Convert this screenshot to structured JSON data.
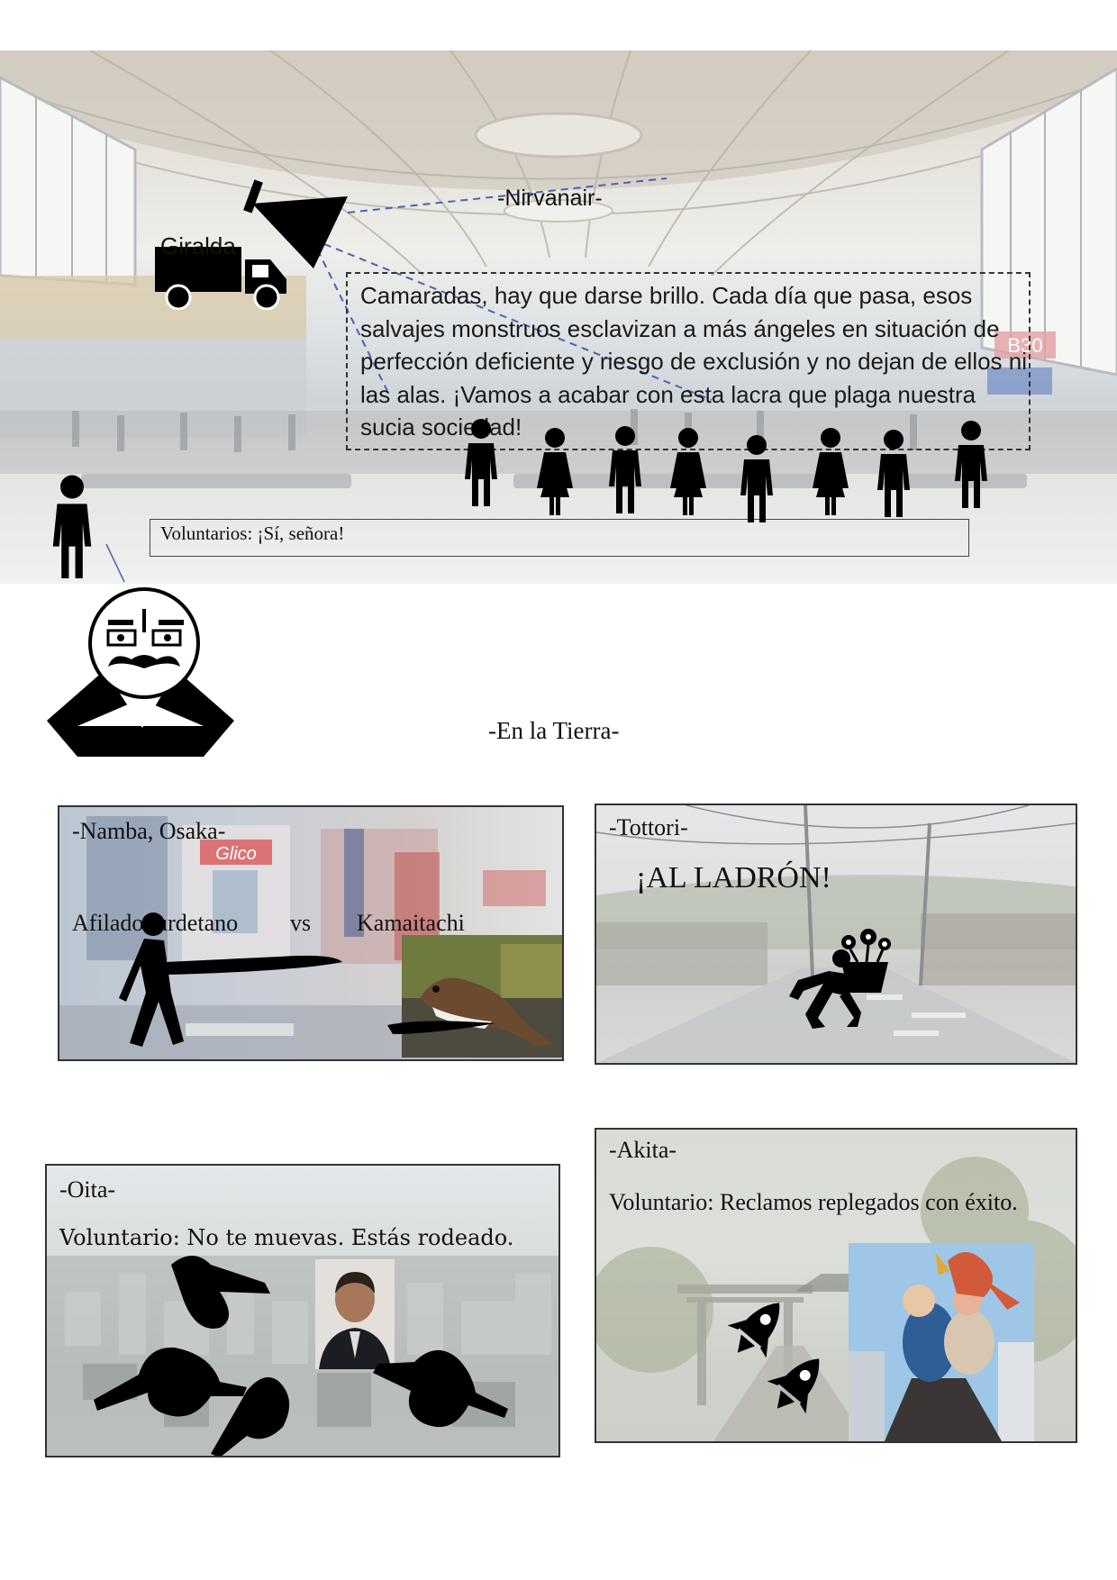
{
  "airport_scene": {
    "location_title": "-Nirvanair-",
    "speaker_label": "Giralda",
    "speech": "Camaradas, hay que darse brillo. Cada día que pasa, esos salvajes monstruos esclavizan a más ángeles en situación de perfección deficiente y riesgo de exclusión y no dejan de ellos ni las alas. ¡Vamos a acabar con esta lacra que plaga nuestra sucia sociedad!",
    "volunteers_reply": "Voluntarios:  ¡Sí, señora!",
    "gate_sign": "B30"
  },
  "earth_heading": "-En la Tierra-",
  "panels": {
    "namba": {
      "title": "-Namba, Osaka-",
      "fighter_left": "Afilado turdetano",
      "versus": "vs",
      "fighter_right": "Kamaitachi",
      "sign_glico": "Glico"
    },
    "tottori": {
      "title": "-Tottori-",
      "shout": "¡AL LADRÓN!"
    },
    "oita": {
      "title": "-Oita-",
      "line": "Voluntario: No te muevas. Estás rodeado."
    },
    "akita": {
      "title": "-Akita-",
      "line": "Voluntario: Reclamos replegados con éxito."
    }
  },
  "icons": [
    "truck-icon",
    "megaphone-icon",
    "person-icon",
    "meme-face-icon",
    "runner-icon",
    "stoat-photo",
    "flower-pot-icon",
    "pointing-hand-icon",
    "rocket-icon",
    "statue-photo"
  ]
}
